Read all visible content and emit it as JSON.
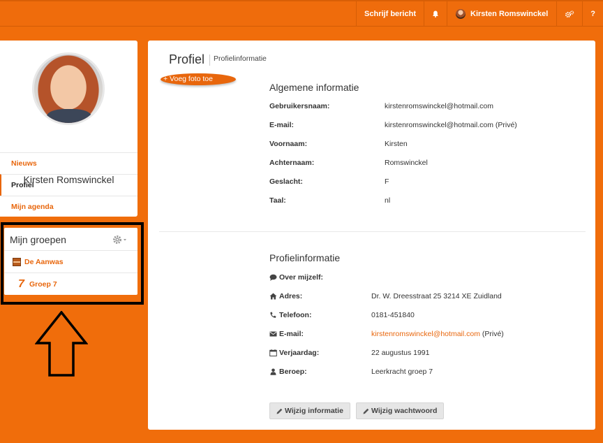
{
  "colors": {
    "brand": "#ef6c0c",
    "link": "#e8660c",
    "highlight": "#000000"
  },
  "navbar": {
    "write_message": "Schrijf bericht",
    "notifications_icon": "bell-icon",
    "user_name": "Kirsten Romswinckel",
    "settings_icon": "gears-icon",
    "help": "?"
  },
  "sidebar": {
    "profile_name": "Kirsten Romswinckel",
    "nav": [
      {
        "label": "Nieuws",
        "active": false
      },
      {
        "label": "Profiel",
        "active": true
      },
      {
        "label": "Mijn agenda",
        "active": false
      }
    ],
    "groups": {
      "title": "Mijn groepen",
      "settings_icon": "gear-icon",
      "items": [
        {
          "label": "De Aanwas",
          "icon": "group-logo-icon"
        },
        {
          "label": "Groep 7",
          "icon": "number-seven-icon"
        }
      ]
    }
  },
  "main": {
    "title": "Profiel",
    "subtitle": "Profielinformatie",
    "add_photo": "+ Voeg foto toe",
    "general": {
      "title": "Algemene informatie",
      "fields": [
        {
          "label": "Gebruikersnaam:",
          "value": "kirstenromswinckel@hotmail.com"
        },
        {
          "label": "E-mail:",
          "value": "kirstenromswinckel@hotmail.com (Privé)"
        },
        {
          "label": "Voornaam:",
          "value": "Kirsten"
        },
        {
          "label": "Achternaam:",
          "value": "Romswinckel"
        },
        {
          "label": "Geslacht:",
          "value": "F"
        },
        {
          "label": "Taal:",
          "value": "nl"
        }
      ]
    },
    "profile": {
      "title": "Profielinformatie",
      "fields": [
        {
          "label": "Over mijzelf:",
          "icon": "comment-icon",
          "value": ""
        },
        {
          "label": "Adres:",
          "icon": "home-icon",
          "value": "Dr. W. Dreesstraat 25 3214 XE Zuidland"
        },
        {
          "label": "Telefoon:",
          "icon": "phone-icon",
          "value": "0181-451840"
        },
        {
          "label": "E-mail:",
          "icon": "envelope-icon",
          "value": "kirstenromswinckel@hotmail.com",
          "suffix": "(Privé)"
        },
        {
          "label": "Verjaardag:",
          "icon": "calendar-icon",
          "value": "22 augustus 1991"
        },
        {
          "label": "Beroep:",
          "icon": "user-icon",
          "value": "Leerkracht groep 7"
        }
      ]
    },
    "buttons": {
      "edit_info": "Wijzig informatie",
      "edit_password": "Wijzig wachtwoord"
    }
  }
}
